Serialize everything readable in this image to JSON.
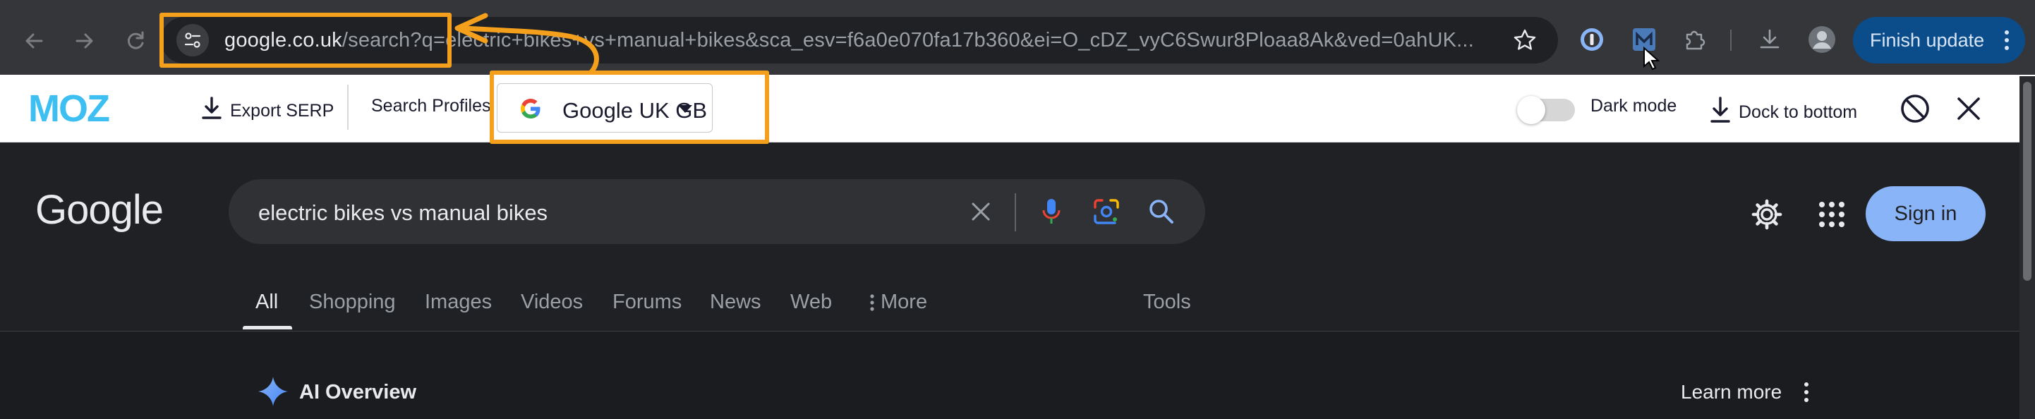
{
  "browser": {
    "url_host": "google.co.uk",
    "url_rest": "/search?q=electric+bikes+vs+manual+bikes&sca_esv=f6a0e070fa17b360&ei=O_cDZ_vyC6Swur8Ploaa8Ak&ved=0ahUK...",
    "finish_update_label": "Finish update",
    "nav_icons": [
      "back-arrow-icon",
      "forward-arrow-icon",
      "reload-icon"
    ]
  },
  "mozbar": {
    "logo_text": "MOZ",
    "export_label": "Export SERP",
    "search_profiles_label": "Search Profiles",
    "profile_value": "Google UK GB",
    "dark_mode_label": "Dark mode",
    "dock_label": "Dock to bottom"
  },
  "google": {
    "logo_text": "Google",
    "query": "electric bikes vs manual bikes",
    "sign_in_label": "Sign in",
    "tabs": [
      "All",
      "Shopping",
      "Images",
      "Videos",
      "Forums",
      "News",
      "Web",
      "More",
      "Tools"
    ],
    "active_tab": "All",
    "ai_overview_label": "AI Overview",
    "learn_more_label": "Learn more"
  },
  "colors": {
    "annotation": "#f5a01c",
    "moz_blue": "#3dbff2",
    "finish_update_bg": "#0b4c8a",
    "sign_in_bg": "#8ab4f8",
    "google_bg": "#202124"
  }
}
